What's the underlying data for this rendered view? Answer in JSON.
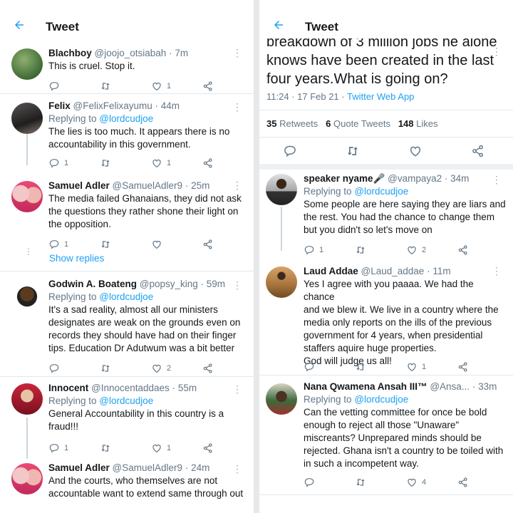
{
  "left": {
    "header": {
      "title": "Tweet"
    },
    "tweets": [
      {
        "name": "Blachboy",
        "handle": "@joojo_otsiabah",
        "time": "· 7m",
        "replying_prefix": "",
        "replying_to": "",
        "text": [
          "This is cruel. Stop it."
        ],
        "replies": "",
        "retweets": "",
        "likes": "1"
      },
      {
        "name": "Felix",
        "handle": "@FelixFelixayumu",
        "time": "· 44m",
        "replying_prefix": "Replying to ",
        "replying_to": "@lordcudjoe",
        "text": [
          "The lies is too much. It appears there is no",
          "accountability in this government."
        ],
        "replies": "1",
        "retweets": "",
        "likes": "1"
      },
      {
        "name": "Samuel Adler",
        "handle": "@SamuelAdler9",
        "time": "· 25m",
        "replying_prefix": "",
        "replying_to": "",
        "text": [
          "The media failed Ghanaians, they did not ask",
          "the questions they rather shone their light on",
          "the opposition."
        ],
        "replies": "1",
        "retweets": "",
        "likes": ""
      },
      {
        "name": "Godwin A. Boateng",
        "handle": "@popsy_king",
        "time": "· 59m",
        "replying_prefix": "Replying to ",
        "replying_to": "@lordcudjoe",
        "text": [
          "It's a sad reality, almost all our ministers",
          "designates are weak on the grounds even on",
          "records they should have had on their finger",
          "tips. Education Dr Adutwum was a bit better"
        ],
        "replies": "",
        "retweets": "",
        "likes": "2"
      },
      {
        "name": "Innocent",
        "handle": "@Innocentaddaes",
        "time": "· 55m",
        "replying_prefix": "Replying to ",
        "replying_to": "@lordcudjoe",
        "text": [
          "General Accountability in this country is a",
          "fraud!!!"
        ],
        "replies": "1",
        "retweets": "",
        "likes": "1"
      },
      {
        "name": "Samuel Adler",
        "handle": "@SamuelAdler9",
        "time": "· 24m",
        "replying_prefix": "",
        "replying_to": "",
        "text": [
          "And the courts, who themselves are not",
          "accountable want to extend same through out"
        ],
        "replies": "",
        "retweets": "",
        "likes": ""
      }
    ],
    "show_replies": "Show replies"
  },
  "right": {
    "header": {
      "title": "Tweet"
    },
    "main": {
      "text": [
        "breakdown of  3 million jobs he alone",
        "knows have been created in the last",
        "four years.What is going on?"
      ],
      "time": "11:24 · 17 Feb 21 · ",
      "app": "Twitter Web App",
      "retweets_count": "35",
      "retweets_label": "Retweets",
      "quotes_count": "6",
      "quotes_label": "Quote Tweets",
      "likes_count": "148",
      "likes_label": "Likes"
    },
    "tweets": [
      {
        "name": "speaker nyame",
        "handle": "@vampaya2",
        "time": "· 34m",
        "replying_prefix": "Replying to ",
        "replying_to": "@lordcudjoe",
        "text": [
          "Some people are here saying they are liars and",
          "the rest. You had the chance to change them",
          "but you didn't so let's move on"
        ],
        "replies": "1",
        "retweets": "",
        "likes": "2"
      },
      {
        "name": "Laud Addae",
        "handle": "@Laud_addae",
        "time": "· 11m",
        "replying_prefix": "",
        "replying_to": "",
        "text": [
          "Yes I agree with you paaaa. We had the chance",
          "and we blew it. We live in a country where the",
          "media only reports on the ills of the previous",
          "government for 4 years, when presidential",
          "staffers aquire huge properties.",
          "God will judge us all!"
        ],
        "replies": "",
        "retweets": "",
        "likes": "1"
      },
      {
        "name": "Nana Qwamena Ansah III™",
        "handle": "@Ansa...",
        "time": "· 33m",
        "replying_prefix": "Replying to ",
        "replying_to": "@lordcudjoe",
        "text": [
          "Can the vetting committee for once be bold",
          "enough to reject all those \"Unaware\"",
          "miscreants? Unprepared minds should be",
          "rejected. Ghana isn't a country to be toiled with",
          "in such a incompetent way."
        ],
        "replies": "",
        "retweets": "",
        "likes": "4"
      }
    ]
  },
  "colors": {
    "accent": "#1da1f2",
    "secondary_text": "#657786",
    "primary_text": "#14171a"
  }
}
